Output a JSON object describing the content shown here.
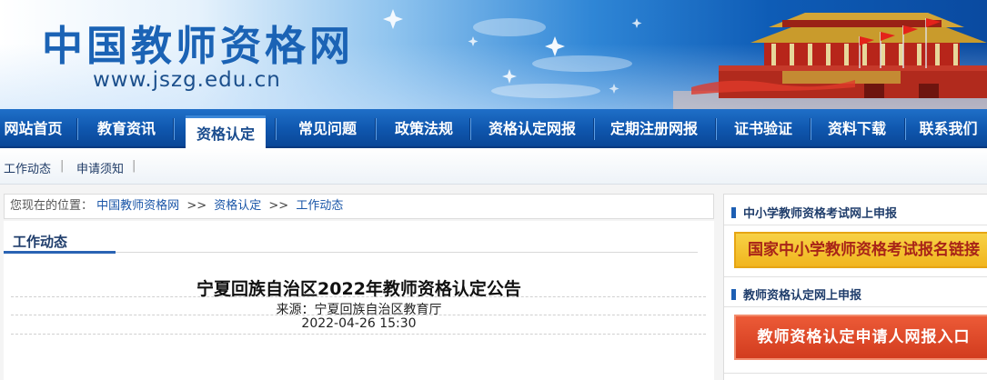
{
  "header": {
    "logo_text": "中国教师资格网",
    "url_text": "www.jszg.edu.cn"
  },
  "nav": {
    "items": [
      {
        "label": "网站首页"
      },
      {
        "label": "教育资讯"
      },
      {
        "label": "资格认定",
        "active": true
      },
      {
        "label": "常见问题"
      },
      {
        "label": "政策法规"
      },
      {
        "label": "资格认定网报"
      },
      {
        "label": "定期注册网报"
      },
      {
        "label": "证书验证"
      },
      {
        "label": "资料下载"
      },
      {
        "label": "联系我们"
      }
    ]
  },
  "subnav": {
    "items": [
      {
        "label": "工作动态"
      },
      {
        "label": "申请须知"
      }
    ],
    "separator": "|"
  },
  "breadcrumb": {
    "prefix": "您现在的位置：",
    "links": [
      "中国教师资格网",
      "资格认定",
      "工作动态"
    ],
    "arrow": ">>"
  },
  "section": {
    "title": "工作动态"
  },
  "article": {
    "title": "宁夏回族自治区2022年教师资格认定公告",
    "source": "来源：宁夏回族自治区教育厅",
    "date": "2022-04-26 15:30"
  },
  "sidebar": {
    "exam_heading": "中小学教师资格考试网上申报",
    "exam_button": "国家中小学教师资格考试报名链接",
    "cert_heading": "教师资格认定网上申报",
    "cert_button": "教师资格认定申请人网报入口"
  },
  "colors": {
    "nav_blue": "#0f56ad",
    "accent_red": "#d23c1e",
    "accent_gold": "#f1b51e"
  }
}
